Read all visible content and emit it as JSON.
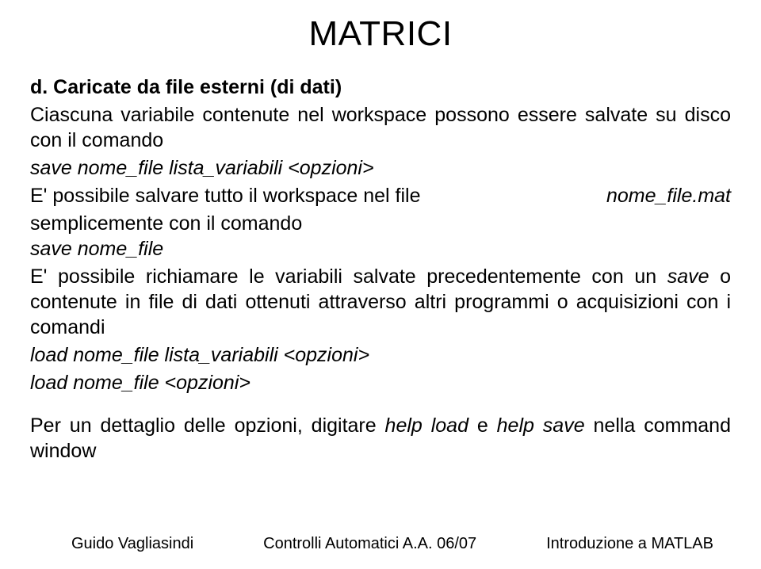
{
  "title": "MATRICI",
  "subheading": "d. Caricate da file esterni (di dati)",
  "p1": "Ciascuna variabile contenute nel workspace possono essere salvate su disco con il comando",
  "code1": "save nome_file lista_variabili <opzioni>",
  "p2_left_a": "E' possibile salvare tutto il workspace nel file ",
  "p2_right": "nome_file.mat",
  "p2_cont": "semplicemente con il comando",
  "code2": "save nome_file",
  "p3_a": "E' possibile richiamare le variabili salvate precedentemente con un ",
  "p3_save": "save",
  "p3_b": " o contenute in file di dati ottenuti attraverso altri programmi o acquisizioni con i comandi",
  "code3": "load nome_file lista_variabili <opzioni>",
  "code4": "load nome_file <opzioni>",
  "p4_a": "Per un dettaglio delle opzioni, digitare ",
  "p4_help_load": "help load",
  "p4_b": " e ",
  "p4_help_save": "help save",
  "p4_c": " nella command window",
  "footer": {
    "left": "Guido Vagliasindi",
    "center": "Controlli Automatici A.A. 06/07",
    "right": "Introduzione a MATLAB"
  }
}
